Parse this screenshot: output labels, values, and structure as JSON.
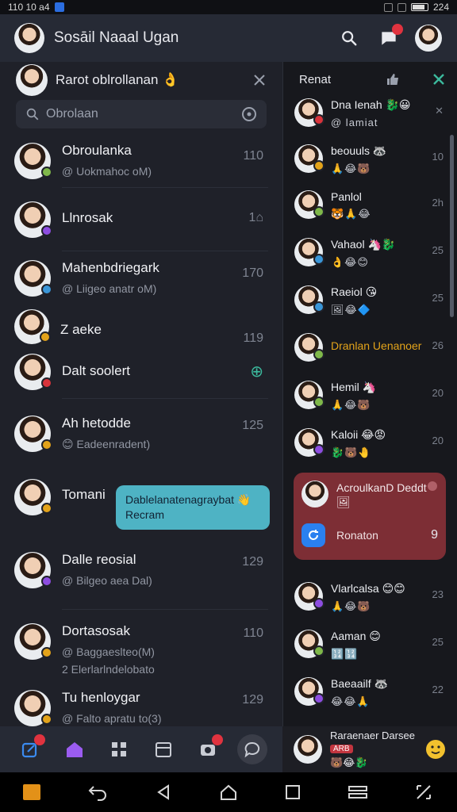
{
  "status": {
    "time_left": "110 10 a4",
    "time_right": "224"
  },
  "app": {
    "title": "Sosāil Naaal Ugan"
  },
  "left": {
    "header": "Rarot oblrollanan",
    "header_emoji": "👌",
    "search_placeholder": "Obrolaan",
    "chats": [
      {
        "name": "Obroulanka",
        "sub": "@ Uokmahoc oM)",
        "time": "110",
        "badge": "#7fb84a"
      },
      {
        "name": "Llnrosak",
        "sub": "",
        "time": "1⌂",
        "badge": "#8d4de0"
      },
      {
        "name": "Mahenbdriegark",
        "sub": "@ Liigeo anatr oM)",
        "time": "170",
        "badge": "#3a96d8"
      },
      {
        "name": "Z aeke",
        "sub": "",
        "time": "119",
        "badge": "#e3a31a"
      },
      {
        "name": "Dalt soolert",
        "sub": "",
        "time": "⊕",
        "badge": "#d8333b"
      },
      {
        "name": "Ah hetodde",
        "sub": "😊 Eadeenradent)",
        "time": "125",
        "badge": "#e3a31a"
      },
      {
        "name": "Tomani",
        "sub": "",
        "time": "",
        "badge": "#e3a31a"
      },
      {
        "name": "Dalle reosial",
        "sub": "@ Bilgeo aea Dal)",
        "time": "129",
        "badge": "#8d4de0"
      },
      {
        "name": "Dortasosak",
        "sub": "@ Baggaeslteo(M)",
        "sub2": "2 Elerlarlndelobato",
        "time": "110",
        "badge": "#e3a31a"
      },
      {
        "name": "Tu henloygar",
        "sub": "@ Falto apratu to(3)",
        "time": "129",
        "badge": "#e3a31a"
      }
    ],
    "bubble": {
      "line1": "Dablelanatenagraybat 👋",
      "line2": "Recram"
    }
  },
  "right": {
    "header": "Renat",
    "contacts": [
      {
        "name": "Dna Ienah 🐉😀",
        "emojis": "@ lamiat",
        "time": "✕",
        "badge": "#d8333b"
      },
      {
        "name": "beouuls 🦝",
        "emojis": "🙏😂🐻",
        "time": "10",
        "badge": "#e3a31a"
      },
      {
        "name": "Panlol",
        "emojis": "🐯🙏😂",
        "time": "2h",
        "badge": "#7fb84a"
      },
      {
        "name": "Vahaol 🦄🐉",
        "emojis": "👌😂😊",
        "time": "25",
        "badge": "#3a96d8"
      },
      {
        "name": "Raeiol 😘",
        "emojis": "🖼😂🔷",
        "time": "25",
        "badge": "#3a96d8"
      },
      {
        "name": "Dranlan Uenanoer",
        "emojis": "",
        "time": "26",
        "badge": "#7fb84a"
      },
      {
        "name": "Hemil 🦄",
        "emojis": "🙏😂🐻",
        "time": "20",
        "badge": "#7fb84a"
      },
      {
        "name": "Kaloii 😂😡",
        "emojis": "🐉🐻🤚",
        "time": "20",
        "badge": "#8d4de0"
      },
      {
        "name": "Vlarlcalsa 😊😊",
        "emojis": "🙏😂🐻",
        "time": "23",
        "badge": "#8d4de0"
      },
      {
        "name": "Aaman 😊",
        "emojis": "🔢🔢",
        "time": "25",
        "badge": "#7fb84a"
      },
      {
        "name": "Baeaailf 🦝",
        "emojis": "😂😂🙏",
        "time": "22",
        "badge": "#8d4de0"
      }
    ],
    "notification": {
      "name": "AcroulkanD Deddt",
      "sub": "🖼",
      "label": "Ronaton",
      "count": "9"
    },
    "bottom": {
      "tag": "ARB",
      "name": "Raraenaer Darsee",
      "emojis": "🐻😂🐉"
    }
  }
}
